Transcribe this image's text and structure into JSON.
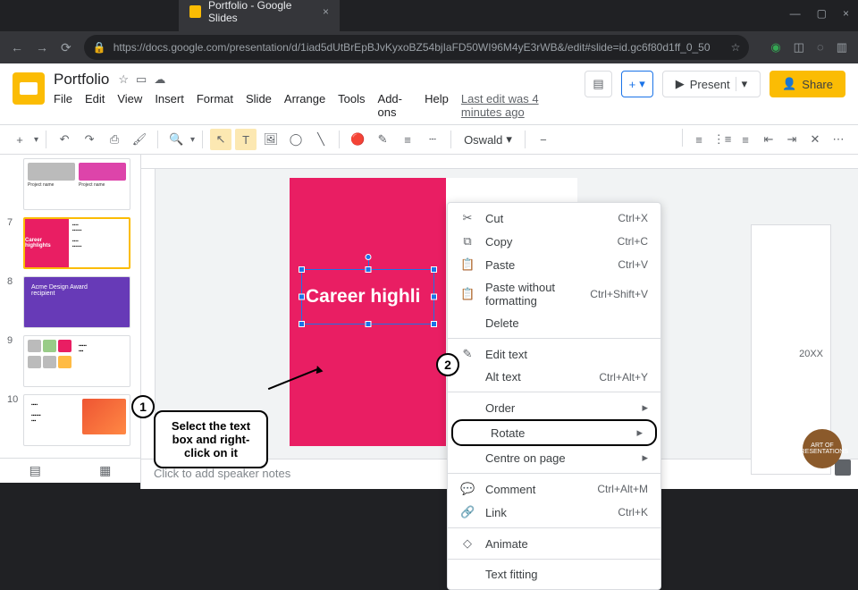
{
  "browser": {
    "tab_title": "Portfolio - Google Slides",
    "tab_close": "×",
    "window_min": "—",
    "window_max": "▢",
    "window_close": "×",
    "nav_back": "←",
    "nav_fwd": "→",
    "nav_reload": "⟳",
    "lock": "🔒",
    "url": "https://docs.google.com/presentation/d/1iad5dUtBrEpBJvKyxoBZ54bjIaFD50WI96M4yE3rWB&/edit#slide=id.gc6f80d1ff_0_50",
    "star": "☆"
  },
  "doc": {
    "title": "Portfolio",
    "star": "☆",
    "move": "▭",
    "cloud": "☁"
  },
  "menus": {
    "file": "File",
    "edit": "Edit",
    "view": "View",
    "insert": "Insert",
    "format": "Format",
    "slide": "Slide",
    "arrange": "Arrange",
    "tools": "Tools",
    "addons": "Add-ons",
    "help": "Help",
    "last_edit": "Last edit was 4 minutes ago"
  },
  "header_buttons": {
    "comments": "▤",
    "add_box": "+",
    "present": "Present",
    "present_icon": "▶",
    "share": "Share",
    "share_icon": "👤"
  },
  "toolbar": {
    "new_slide": "+",
    "undo": "↶",
    "redo": "↷",
    "print": "⎙",
    "paint": "🖌",
    "zoom": "🔍",
    "select": "▭",
    "textbox": "T",
    "image": "🖼",
    "shape": "◯",
    "line": "╲",
    "fill": "▬",
    "border": "▭",
    "weight": "≡",
    "dash": "┄",
    "font": "Oswald",
    "font_arrow": "▾",
    "minus": "−",
    "list1": "≡",
    "list2": "⋮≡",
    "list3": "≡",
    "indent_dec": "⇤",
    "indent_inc": "⇥",
    "clear": "✕",
    "more": "⋯"
  },
  "thumbs": {
    "n7": "7",
    "n8": "8",
    "n9": "9",
    "n10": "10",
    "career": "Career highlights",
    "acme1": "Acme Design Award",
    "acme2": "recipient"
  },
  "slide": {
    "text": "Career highli"
  },
  "ctx": {
    "cut": "Cut",
    "cut_sc": "Ctrl+X",
    "copy": "Copy",
    "copy_sc": "Ctrl+C",
    "paste": "Paste",
    "paste_sc": "Ctrl+V",
    "paste_wf": "Paste without formatting",
    "paste_wf_sc": "Ctrl+Shift+V",
    "delete": "Delete",
    "edit_text": "Edit text",
    "alt_text": "Alt text",
    "alt_text_sc": "Ctrl+Alt+Y",
    "order": "Order",
    "rotate": "Rotate",
    "centre": "Centre on page",
    "comment": "Comment",
    "comment_sc": "Ctrl+Alt+M",
    "link": "Link",
    "link_sc": "Ctrl+K",
    "animate": "Animate",
    "text_fitting": "Text fitting",
    "arrow": "▸"
  },
  "right_panel": {
    "year": "20XX"
  },
  "notes": {
    "placeholder": "Click to add speaker notes"
  },
  "annotations": {
    "step1_num": "1",
    "step1_text": "Select the text box and right-click on it",
    "step2_num": "2"
  },
  "watermark": "ART OF PRESENTATIONS"
}
